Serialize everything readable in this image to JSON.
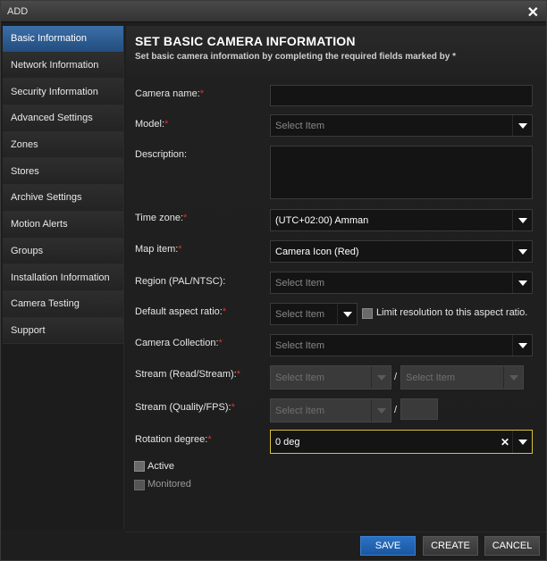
{
  "window": {
    "title": "ADD",
    "close_glyph": "✕"
  },
  "sidebar": {
    "items": [
      {
        "label": "Basic Information",
        "active": true
      },
      {
        "label": "Network Information"
      },
      {
        "label": "Security Information"
      },
      {
        "label": "Advanced Settings"
      },
      {
        "label": "Zones"
      },
      {
        "label": "Stores"
      },
      {
        "label": "Archive Settings"
      },
      {
        "label": "Motion Alerts"
      },
      {
        "label": "Groups"
      },
      {
        "label": "Installation Information"
      },
      {
        "label": "Camera Testing"
      },
      {
        "label": "Support"
      }
    ]
  },
  "form": {
    "heading": "SET BASIC CAMERA INFORMATION",
    "subheading": "Set basic camera information by completing the required fields marked by *",
    "required_mark": "*",
    "camera_name": {
      "label": "Camera name:",
      "value": ""
    },
    "model": {
      "label": "Model:",
      "value": "Select Item"
    },
    "description": {
      "label": "Description:",
      "value": ""
    },
    "time_zone": {
      "label": "Time zone:",
      "value": "(UTC+02:00) Amman"
    },
    "map_item": {
      "label": "Map item:",
      "value": "Camera Icon (Red)"
    },
    "region": {
      "label": "Region (PAL/NTSC):",
      "value": "Select Item"
    },
    "aspect_ratio": {
      "label": "Default aspect ratio:",
      "value": "Select Item",
      "limit_label": "Limit resolution to this aspect ratio."
    },
    "camera_collection": {
      "label": "Camera Collection:",
      "value": "Select Item"
    },
    "stream_read": {
      "label": "Stream (Read/Stream):",
      "value1": "Select Item",
      "separator": "/",
      "value2": "Select Item"
    },
    "stream_quality": {
      "label": "Stream (Quality/FPS):",
      "value1": "Select Item",
      "separator": "/",
      "value2": ""
    },
    "rotation": {
      "label": "Rotation degree:",
      "value": "0 deg",
      "clear_glyph": "✕"
    },
    "active": {
      "label": "Active"
    },
    "monitored": {
      "label": "Monitored"
    }
  },
  "footer": {
    "save": "SAVE",
    "create": "CREATE",
    "cancel": "CANCEL"
  },
  "colors": {
    "accent": "#2a72c4",
    "required": "#e03030",
    "focus": "#d8c23a"
  }
}
